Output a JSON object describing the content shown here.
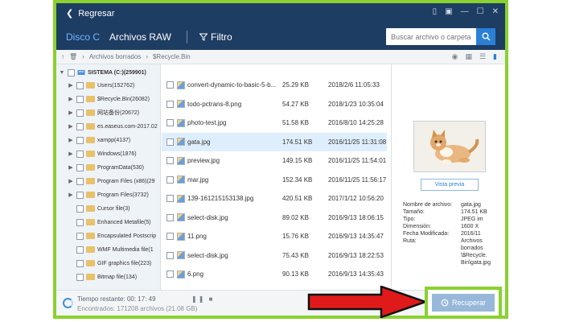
{
  "titlebar": {
    "back_label": "Regresar"
  },
  "nav": {
    "tab_disk": "Disco C",
    "tab_raw": "Archivos RAW",
    "filter_label": "Filtro",
    "search_placeholder": "Buscar archivo o carpeta"
  },
  "breadcrumb": {
    "path1": "Archivos borrados",
    "path2": "$Recycle.Bin"
  },
  "tree": {
    "root": "SISTEMA (C:)(259901)",
    "items": [
      {
        "label": "Users(152762)",
        "expandable": true
      },
      {
        "label": "$Recycle.Bin(26082)",
        "expandable": true
      },
      {
        "label": "网站备份(20672)",
        "expandable": true
      },
      {
        "label": "es.easeus.com-2017.02",
        "expandable": true
      },
      {
        "label": "xampp(4137)",
        "expandable": true
      },
      {
        "label": "Windows(1876)",
        "expandable": true
      },
      {
        "label": "ProgramData(530)",
        "expandable": true
      },
      {
        "label": "Program Files (x86)(29",
        "expandable": true
      },
      {
        "label": "Program Files(3732)",
        "expandable": true
      },
      {
        "label": "Cursor file(3)",
        "expandable": false
      },
      {
        "label": "Enhanced Metafile(5)",
        "expandable": false
      },
      {
        "label": "Encapsulated Postscrip",
        "expandable": false
      },
      {
        "label": "WMF Multimedia file(1",
        "expandable": false
      },
      {
        "label": "GIF graphics file(223)",
        "expandable": false
      },
      {
        "label": "Bitmap file(134)",
        "expandable": false
      }
    ]
  },
  "files": [
    {
      "name": "convert-dynamic-to-basic-5-b...",
      "size": "25.29 KB",
      "date": "2018/2/6 11:05:33"
    },
    {
      "name": "todo-pctrans-8.png",
      "size": "54.27 KB",
      "date": "2018/1/23 10:35:04"
    },
    {
      "name": "photo-test.jpg",
      "size": "51.58 KB",
      "date": "2016/8/10 14:25:28"
    },
    {
      "name": "gata.jpg",
      "size": "174.51 KB",
      "date": "2016/11/25 11:31:08"
    },
    {
      "name": "preview.jpg",
      "size": "149.15 KB",
      "date": "2016/11/25 11:54:01"
    },
    {
      "name": "mar.jpg",
      "size": "152.34 KB",
      "date": "2016/11/25 11:56:17"
    },
    {
      "name": "139-161215153138.jpg",
      "size": "420.51 KB",
      "date": "2017/1/12 10:56:20"
    },
    {
      "name": "select-disk.jpg",
      "size": "89.02 KB",
      "date": "2016/9/13 18:06:15"
    },
    {
      "name": "11.png",
      "size": "15.76 KB",
      "date": "2016/9/13 14:35:47"
    },
    {
      "name": "select-disk.jpg",
      "size": "75.43 KB",
      "date": "2016/9/13 18:22:53"
    },
    {
      "name": "6.png",
      "size": "90.13 KB",
      "date": "2016/9/13 14:35:43"
    }
  ],
  "preview": {
    "button_label": "Vista previa",
    "props": [
      {
        "key": "Nombre de archivo:",
        "value": "gata.jpg"
      },
      {
        "key": "Tamaño:",
        "value": "174.51 KB"
      },
      {
        "key": "Tipo:",
        "value": "JPEG im"
      },
      {
        "key": "Dimensión:",
        "value": "1600 X"
      },
      {
        "key": "Fecha Modificada:",
        "value": "2016/11"
      },
      {
        "key": "Ruta:",
        "value": "Archivos borrados \\$Recycle. Bin\\gata.jpg"
      }
    ]
  },
  "status": {
    "remaining": "Tiempo restante: 00: 17: 49",
    "found": "Encontrados: 171208 archivos (21.08 GB)"
  },
  "recover_label": "Recuperar",
  "colors": {
    "highlight": "#8ad12f",
    "arrow": "#e01a1a",
    "titlebar": "#1e3d63",
    "accent": "#2a7fd6"
  }
}
